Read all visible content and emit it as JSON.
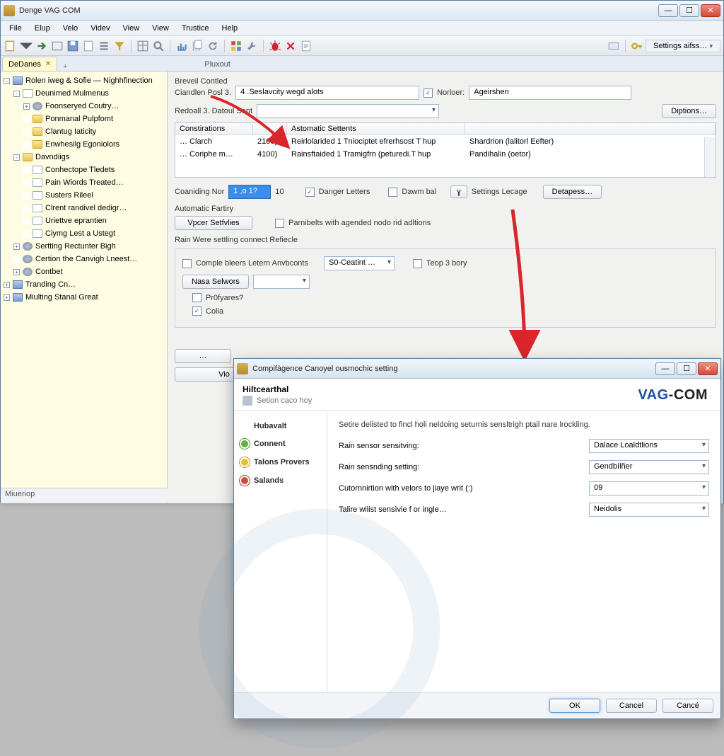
{
  "app": {
    "title": "Denge VAG COM"
  },
  "menu": [
    "File",
    "Elup",
    "Velo",
    "Videv",
    "View",
    "View",
    "Trustice",
    "Help"
  ],
  "toolbar_right": {
    "settings_label": "Settings aifss…"
  },
  "tabs": {
    "active": "DeDanes",
    "right_hint": "Pluxout"
  },
  "tree": [
    {
      "depth": 0,
      "twisty": "-",
      "icon": "mod",
      "label": "Rolen iweg & Sofie — Nighhfinection"
    },
    {
      "depth": 1,
      "twisty": "-",
      "icon": "page",
      "label": "Deunimed Mulmenus"
    },
    {
      "depth": 2,
      "twisty": "+",
      "icon": "gear",
      "label": "Foonseryed Coutry…"
    },
    {
      "depth": 2,
      "twisty": "",
      "icon": "folder",
      "label": "Ponmanal Pulpfomt"
    },
    {
      "depth": 2,
      "twisty": "",
      "icon": "folder",
      "label": "Clantug Iaticity"
    },
    {
      "depth": 2,
      "twisty": "",
      "icon": "folder",
      "label": "Enwhesilg Egoniolors"
    },
    {
      "depth": 1,
      "twisty": "-",
      "icon": "folder",
      "label": "Davndiigs"
    },
    {
      "depth": 2,
      "twisty": "",
      "icon": "page",
      "label": "Conhectope Tledets"
    },
    {
      "depth": 2,
      "twisty": "",
      "icon": "page",
      "label": "Pain Wiords Treated…"
    },
    {
      "depth": 2,
      "twisty": "",
      "icon": "page",
      "label": "Susters Rileel"
    },
    {
      "depth": 2,
      "twisty": "",
      "icon": "page",
      "label": "Clrent randivel dedigr…"
    },
    {
      "depth": 2,
      "twisty": "",
      "icon": "page",
      "label": "Uriettve eprantien"
    },
    {
      "depth": 2,
      "twisty": "",
      "icon": "page",
      "label": "Ciymg Lest a Ustegt"
    },
    {
      "depth": 1,
      "twisty": "+",
      "icon": "gear",
      "label": "Sertting Rectunter Bigh"
    },
    {
      "depth": 1,
      "twisty": "",
      "icon": "gear",
      "label": "Certion the Canvigh Lneest…"
    },
    {
      "depth": 1,
      "twisty": "+",
      "icon": "gear",
      "label": "Contbet"
    },
    {
      "depth": 0,
      "twisty": "+",
      "icon": "mod",
      "label": "Tranding Cn…"
    },
    {
      "depth": 0,
      "twisty": "+",
      "icon": "mod",
      "label": "Miulting Stanal Great"
    }
  ],
  "statusbar_left": "Miueriop",
  "panel": {
    "breveil_label": "Breveil Contled",
    "cianden_label": "Ciandlen Posl 3.",
    "cianden_value": "4 .Seslavcity wegd alots",
    "norloer_label": "Norloer:",
    "norloer_value": "Ageirshen",
    "redoall_label": "Redoall 3. Datoul Sept",
    "redoall_value": "",
    "diptions_btn": "Diptions…",
    "list": {
      "headers": [
        "Constirations",
        "",
        "Astomatic Settents",
        ""
      ],
      "rows": [
        [
          "… Clarch",
          "2100)",
          "Reirlolarided 1  Tniociptet efrerhsost T hup",
          "Shardrion (lalitorl Eefter)"
        ],
        [
          "… Coriphe m…",
          "4100)",
          "Rainsftaided 1  Tramigfrn (peturedi.T hup",
          "Pandihalin (oetor)"
        ]
      ]
    },
    "coaniding_label": "Coaniding Nor",
    "coaniding_value": "1 ,o 1?",
    "coaniding_suffix": "10",
    "danger_letters": "Danger Letters",
    "dawn_bal": "Dawm bal",
    "settings_lecage": "Settings Lecage",
    "detapes_btn": "Detapess…",
    "auto_fartry": "Automatic Fartiry",
    "vper_btn": "Vpcer Setfvlies",
    "parnibets": "Parnibelts with agended nodo rid adltions",
    "rain_refiecle": "Rain Were settling connect Refiecle",
    "comple_letern": "Comple bleers Letern Anvbconts",
    "so_ceatint": "S0-Ceatint …",
    "teop_bory": "Teop 3 bory",
    "nasa_btn": "Nasa Selwors",
    "profyares": "Pr0fyares?",
    "cola": "Colia                                               ",
    "vio_btn": "Vio                              "
  },
  "dialog": {
    "title": "Compifàgence Canoyel ousmochic setting",
    "h1": "Hiltcearthal",
    "h2": "Setion caco hoy",
    "brand1": "VAG",
    "brand2": "-COM",
    "nav": [
      {
        "key": "hubavalt",
        "label": "Hubavalt"
      },
      {
        "key": "connent",
        "label": "Connent",
        "dot": "green"
      },
      {
        "key": "talons",
        "label": "Talons Provers",
        "dot": "yellow"
      },
      {
        "key": "salands",
        "label": "Salands",
        "dot": "red"
      }
    ],
    "desc": "Setire delisted to fincl holi neldoing seturnis sensltrigh ptail nare lrockling.",
    "fields": [
      {
        "label": "Rain sensor sensitving:",
        "value": "Dalace Loaldtlions"
      },
      {
        "label": "Rain sensnding setting:",
        "value": "Gendbílñer"
      },
      {
        "label": "Cutornnirtion with velors to jiaye writ (:)",
        "value": "09"
      },
      {
        "label": "Talire wilist sensìvie f or ingle…",
        "value": "Neidolis"
      }
    ],
    "ok": "OK",
    "cancel": "Cancel",
    "cance": "Cancé"
  },
  "icons": {
    "minimize": "—",
    "maximize": "☐",
    "close": "✕"
  },
  "colors": {
    "accent": "#1a4fa6",
    "sidebar_bg": "#fefde4"
  }
}
